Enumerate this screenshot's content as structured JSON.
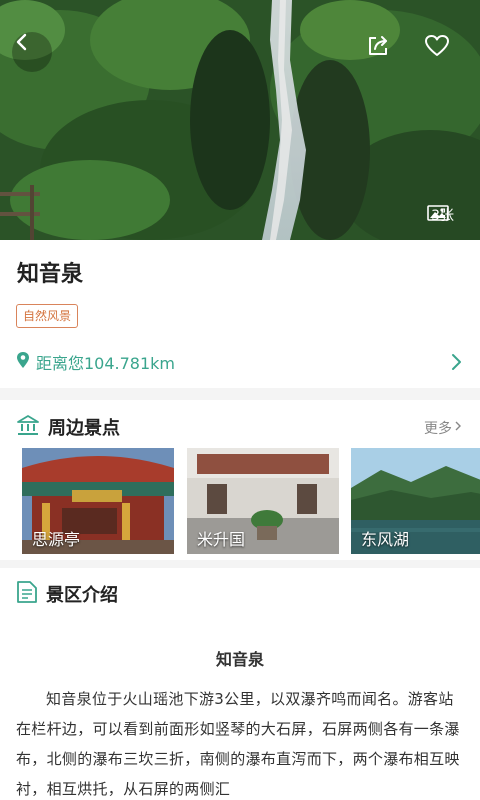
{
  "hero": {
    "photo_count": "3张",
    "icons": {
      "back": "chevron-left-icon",
      "share": "share-icon",
      "favorite": "heart-icon",
      "photos": "image-icon"
    }
  },
  "spot": {
    "title": "知音泉",
    "tag": "自然风景",
    "distance": "距离您104.781km"
  },
  "nearby": {
    "title": "周边景点",
    "more": "更多",
    "items": [
      {
        "name": "思源亭"
      },
      {
        "name": "米升国"
      },
      {
        "name": "东风湖"
      }
    ]
  },
  "intro": {
    "title": "景区介绍",
    "subtitle": "知音泉",
    "body": "知音泉位于火山瑶池下游3公里，以双瀑齐鸣而闻名。游客站在栏杆边，可以看到前面形如竖琴的大石屏，石屏两侧各有一条瀑布，北侧的瀑布三坎三折，南侧的瀑布直泻而下，两个瀑布相互映衬，相互烘托，从石屏的两侧汇"
  },
  "colors": {
    "accent": "#3aa58d",
    "tag": "#d4743f",
    "section_bg": "#f4f4f4"
  }
}
